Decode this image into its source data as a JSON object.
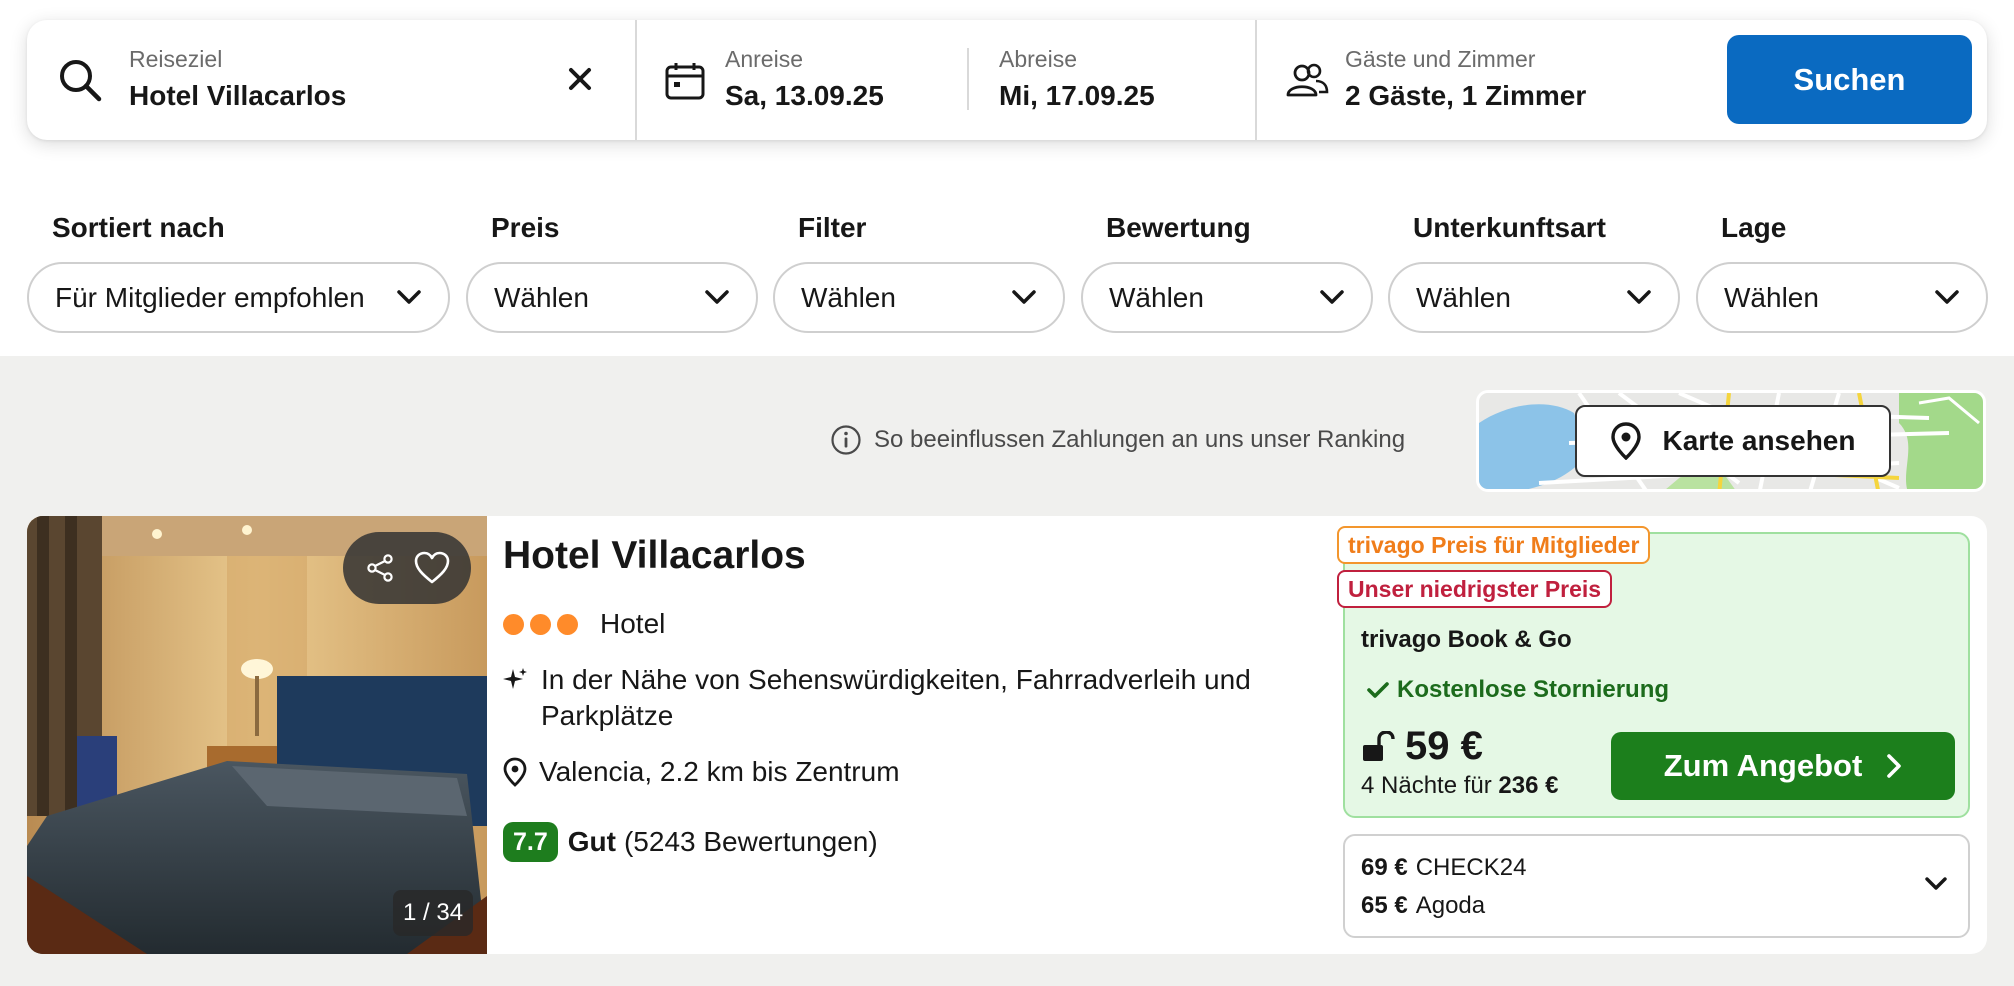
{
  "search": {
    "destination_label": "Reiseziel",
    "destination_value": "Hotel Villacarlos",
    "checkin_label": "Anreise",
    "checkin_value": "Sa, 13.09.25",
    "checkout_label": "Abreise",
    "checkout_value": "Mi, 17.09.25",
    "guests_label": "Gäste und Zimmer",
    "guests_value": "2 Gäste, 1 Zimmer",
    "search_button": "Suchen"
  },
  "filters": [
    {
      "title": "Sortiert nach",
      "value": "Für Mitglieder empfohlen"
    },
    {
      "title": "Preis",
      "value": "Wählen"
    },
    {
      "title": "Filter",
      "value": "Wählen"
    },
    {
      "title": "Bewertung",
      "value": "Wählen"
    },
    {
      "title": "Unterkunftsart",
      "value": "Wählen"
    },
    {
      "title": "Lage",
      "value": "Wählen"
    }
  ],
  "ranking_note": "So beeinflussen Zahlungen an uns unser Ranking",
  "map_button": "Karte ansehen",
  "hotel": {
    "name": "Hotel Villacarlos",
    "stars": 3,
    "type": "Hotel",
    "features": "In der Nähe von Sehenswürdigkeiten, Fahrradverleih und Parkplätze",
    "location": "Valencia, 2.2 km bis Zentrum",
    "rating_score": "7.7",
    "rating_word": "Gut",
    "rating_count": "(5243 Bewertungen)",
    "photo_counter": "1 / 34"
  },
  "deal": {
    "badge_members": "trivago Preis für Mitglieder",
    "badge_lowest": "Unser niedrigster Preis",
    "provider": "trivago Book & Go",
    "cancellation": "Kostenlose Stornierung",
    "price": "59 €",
    "nights_text": "4 Nächte für",
    "nights_total": "236 €",
    "offer_button": "Zum Angebot"
  },
  "other_offers": [
    {
      "price": "69 €",
      "provider": "CHECK24"
    },
    {
      "price": "65 €",
      "provider": "Agoda"
    }
  ],
  "colors": {
    "primary_blue": "#0a6ac1",
    "offer_green": "#1c7f1c",
    "rating_green": "#1e7d1e",
    "star_orange": "#ff8b2a",
    "badge_orange": "#f07d1a",
    "badge_red": "#c0203e"
  }
}
